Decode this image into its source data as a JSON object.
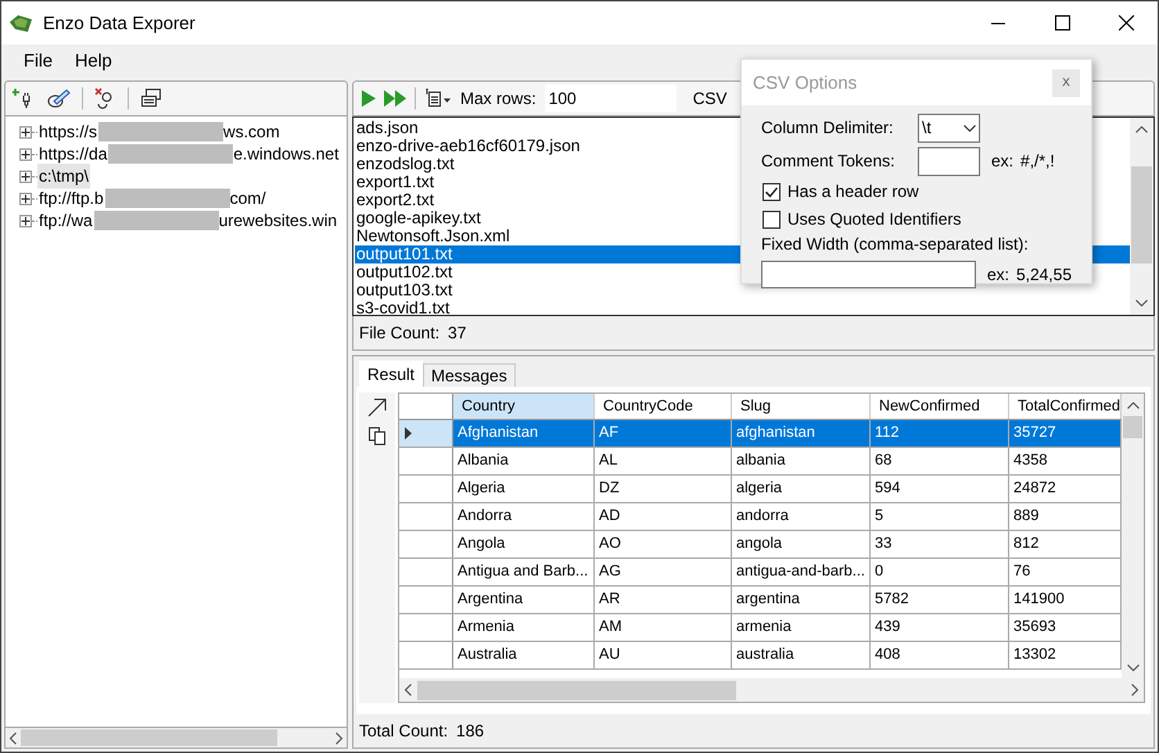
{
  "window": {
    "title": "Enzo Data Exporer"
  },
  "menu": [
    "File",
    "Help"
  ],
  "connections": [
    {
      "prefix": "https://s",
      "suffix": "ws.com",
      "redacted": true,
      "selected": false
    },
    {
      "prefix": "https://da",
      "suffix": "e.windows.net",
      "redacted": true,
      "selected": false
    },
    {
      "prefix": "c:\\tmp\\",
      "redacted": false,
      "selected": true
    },
    {
      "prefix": "ftp://ftp.b",
      "suffix": "com/",
      "redacted": true,
      "selected": false
    },
    {
      "prefix": "ftp://wa",
      "suffix": "urewebsites.win",
      "redacted": true,
      "selected": false
    }
  ],
  "query_toolbar": {
    "max_rows_label": "Max rows:",
    "max_rows": "100",
    "csv_button": "CSV"
  },
  "files": [
    {
      "name": "ads.json",
      "selected": false
    },
    {
      "name": "enzo-drive-aeb16cf60179.json",
      "selected": false
    },
    {
      "name": "enzodslog.txt",
      "selected": false
    },
    {
      "name": "export1.txt",
      "selected": false
    },
    {
      "name": "export2.txt",
      "selected": false
    },
    {
      "name": "google-apikey.txt",
      "selected": false
    },
    {
      "name": "Newtonsoft.Json.xml",
      "selected": false
    },
    {
      "name": "output101.txt",
      "selected": true
    },
    {
      "name": "output102.txt",
      "selected": false
    },
    {
      "name": "output103.txt",
      "selected": false
    },
    {
      "name": "s3-covid1.txt",
      "selected": false
    }
  ],
  "file_count": {
    "label": "File Count:",
    "value": "37"
  },
  "tabs": [
    {
      "label": "Result",
      "selected": true
    },
    {
      "label": "Messages",
      "selected": false
    }
  ],
  "table": {
    "columns": [
      "Country",
      "CountryCode",
      "Slug",
      "NewConfirmed",
      "TotalConfirmed"
    ],
    "rows": [
      {
        "cells": [
          "Afghanistan",
          "AF",
          "afghanistan",
          "112",
          "35727"
        ],
        "selected": true
      },
      {
        "cells": [
          "Albania",
          "AL",
          "albania",
          "68",
          "4358"
        ],
        "selected": false
      },
      {
        "cells": [
          "Algeria",
          "DZ",
          "algeria",
          "594",
          "24872"
        ],
        "selected": false
      },
      {
        "cells": [
          "Andorra",
          "AD",
          "andorra",
          "5",
          "889"
        ],
        "selected": false
      },
      {
        "cells": [
          "Angola",
          "AO",
          "angola",
          "33",
          "812"
        ],
        "selected": false
      },
      {
        "cells": [
          "Antigua and Barb...",
          "AG",
          "antigua-and-barb...",
          "0",
          "76"
        ],
        "selected": false
      },
      {
        "cells": [
          "Argentina",
          "AR",
          "argentina",
          "5782",
          "141900"
        ],
        "selected": false
      },
      {
        "cells": [
          "Armenia",
          "AM",
          "armenia",
          "439",
          "35693"
        ],
        "selected": false
      },
      {
        "cells": [
          "Australia",
          "AU",
          "australia",
          "408",
          "13302"
        ],
        "selected": false
      }
    ]
  },
  "total_count": {
    "label": "Total Count:",
    "value": "186"
  },
  "csv_options": {
    "title": "CSV Options",
    "close": "x",
    "delimiter_label": "Column Delimiter:",
    "delimiter": "\\t",
    "comment_label": "Comment Tokens:",
    "comment_example_label": "ex:",
    "comment_example": "#,/*,!",
    "checkboxes": [
      {
        "label": "Has a header row",
        "checked": true
      },
      {
        "label": "Uses Quoted Identifiers",
        "checked": false
      }
    ],
    "fixed_width_label": "Fixed Width (comma-separated list):",
    "fixed_width_example_label": "ex:",
    "fixed_width_example": "5,24,55"
  }
}
